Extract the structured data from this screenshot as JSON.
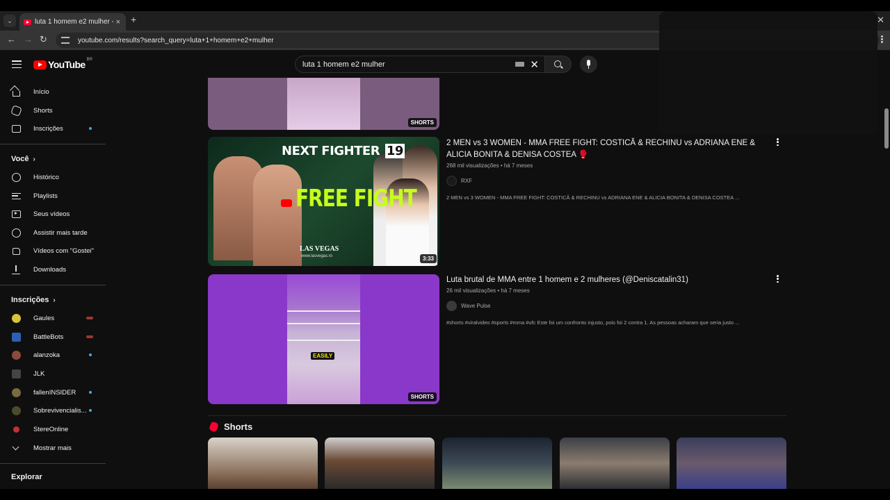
{
  "browser": {
    "tab_title": "luta 1 homem e2 mulher - YouTube",
    "url": "youtube.com/results?search_query=luta+1+homem+e2+mulher",
    "tab_close": "×",
    "new_tab": "+",
    "window_close": "✕"
  },
  "masthead": {
    "logo_text": "YouTube",
    "country_code": "BR",
    "search_value": "luta 1 homem e2 mulher",
    "clear_symbol": "✕"
  },
  "sidebar": {
    "main": [
      {
        "label": "Início",
        "icon": "home-icon"
      },
      {
        "label": "Shorts",
        "icon": "shorts-icon"
      },
      {
        "label": "Inscrições",
        "icon": "subscriptions-icon"
      }
    ],
    "you_header": "Você",
    "you_items": [
      {
        "label": "Histórico",
        "icon": "history-icon"
      },
      {
        "label": "Playlists",
        "icon": "playlists-icon"
      },
      {
        "label": "Seus vídeos",
        "icon": "your-videos-icon"
      },
      {
        "label": "Assistir mais tarde",
        "icon": "watch-later-icon"
      },
      {
        "label": "Vídeos com \"Gostei\"",
        "icon": "liked-icon"
      },
      {
        "label": "Downloads",
        "icon": "download-icon"
      }
    ],
    "subs_header": "Inscrições",
    "subs": [
      {
        "label": "Gaules",
        "color": "#d7c33a"
      },
      {
        "label": "BattleBots",
        "color": "#2f5fb3"
      },
      {
        "label": "alanzoka",
        "color": "#8a4b3c"
      },
      {
        "label": "JLK",
        "color": "#444444"
      },
      {
        "label": "fallenINSIDER",
        "color": "#7a6a40"
      },
      {
        "label": "Sobrevivencialis...",
        "color": "#4b4b2a"
      },
      {
        "label": "StereOnline",
        "color": "#c43030"
      }
    ],
    "show_more": "Mostrar mais",
    "explore_header": "Explorar"
  },
  "results": {
    "prev_short_badge": "SHORTS",
    "video1": {
      "title_line1": "2 MEN vs 3 WOMEN - MMA FREE FIGHT: COSTICĂ & RECHINU vs ADRIANA ENE &",
      "title_line2": "ALICIA BONITA & DENISA COSTEA 🥊",
      "meta": "268 mil visualizações • há 7 meses",
      "channel": "RXF",
      "description": "2 MEN vs 3 WOMEN - MMA FREE FIGHT: COSTICĂ & RECHINU vs ADRIANA ENE & ALICIA BONITA & DENISA COSTEA ...",
      "duration": "3:33",
      "thumb_brand": "NEXT FIGHTER",
      "thumb_num": "19",
      "thumb_main": "FREE FIGHT",
      "thumb_venue": "LAS VEGAS",
      "thumb_site": "www.lasvegas.ro"
    },
    "video2": {
      "title": "Luta brutal de MMA entre 1 homem e 2 mulheres (@Deniscatalin31)",
      "meta": "26 mil visualizações • há 7 meses",
      "channel": "Wave Pulse",
      "description": "#shorts #viralvideo #sports #mma #ufc Este foi um confronto injusto, pois foi 2 contra 1. As pessoas acharam que seria justo ...",
      "badge": "SHORTS",
      "thumb_caption": "EASILY"
    },
    "shorts_header": "Shorts"
  }
}
